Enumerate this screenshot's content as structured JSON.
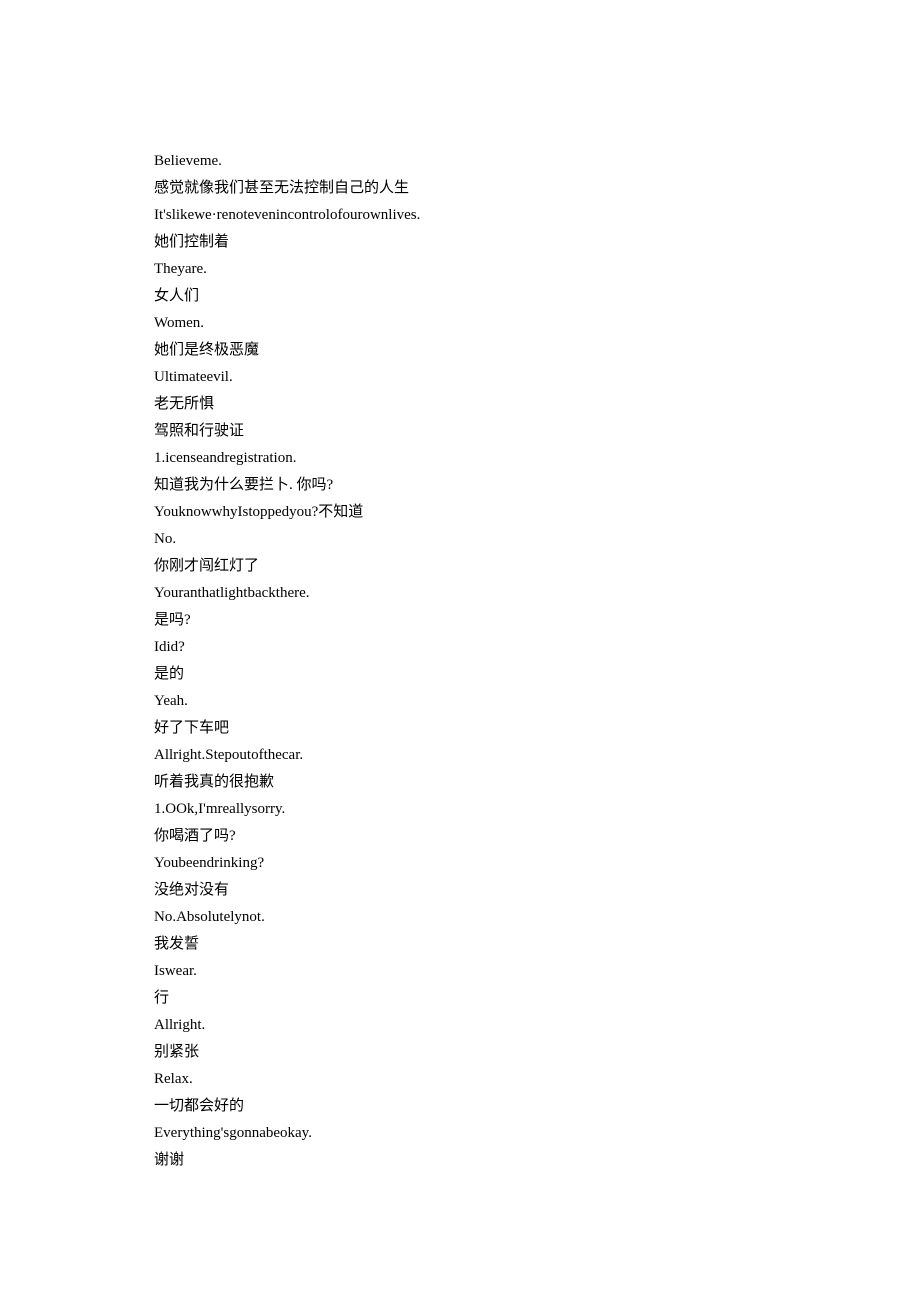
{
  "lines": [
    "Believeme.",
    "感觉就像我们甚至无法控制自己的人生",
    "It'slikewe·renotevenincontrolofourownlives.",
    "她们控制着",
    "Theyare.",
    "女人们",
    "Women.",
    "她们是终极恶魔",
    "Ultimateevil.",
    "老无所惧",
    "驾照和行驶证",
    "1.icenseandregistration.",
    "知道我为什么要拦卜. 你吗?",
    "YouknowwhyIstoppedyou?不知道",
    "No.",
    "你刚才闯红灯了",
    "Youranthatlightbackthere.",
    "是吗?",
    "Idid?",
    "是的",
    "Yeah.",
    "好了下车吧",
    "Allright.Stepoutofthecar.",
    "听着我真的很抱歉",
    "1.OOk,I'mreallysorry.",
    "你喝酒了吗?",
    "Youbeendrinking?",
    "没绝对没有",
    "No.Absolutelynot.",
    "我发誓",
    "Iswear.",
    "行",
    "Allright.",
    "别紧张",
    "Relax.",
    "一切都会好的",
    "Everything'sgonnabeokay.",
    "谢谢"
  ]
}
